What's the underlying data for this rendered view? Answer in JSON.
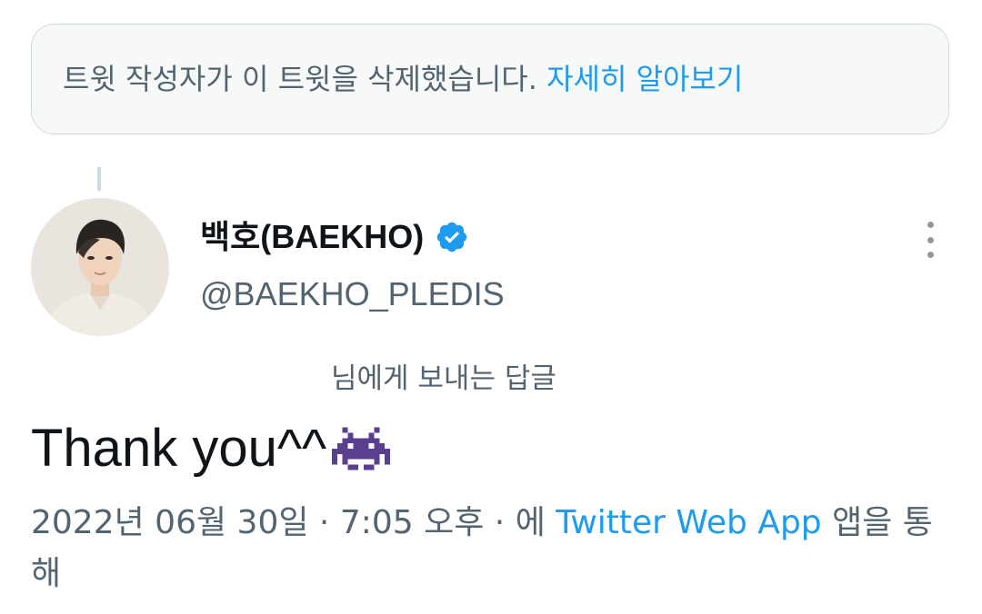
{
  "deleted_notice": {
    "text": "트윗 작성자가 이 트윗을 삭제했습니다.",
    "link": "자세히 알아보기"
  },
  "author": {
    "display_name": "백호(BAEKHO)",
    "handle": "@BAEKHO_PLEDIS",
    "verified": true
  },
  "reply_to": "님에게 보내는 답글",
  "tweet": {
    "text": "Thank you^^",
    "emoji": "alien-monster"
  },
  "meta": {
    "date": "2022년 06월 30일",
    "sep1": " · ",
    "time": "7:05 오후",
    "sep2": " · ",
    "via_prefix": "에 ",
    "source": "Twitter Web App",
    "via_suffix": " 앱을 통해"
  },
  "colors": {
    "link_blue": "#1d9bf0",
    "secondary_text": "#536471",
    "primary_text": "#0f1419",
    "emoji_purple": "#5b3f8f"
  }
}
